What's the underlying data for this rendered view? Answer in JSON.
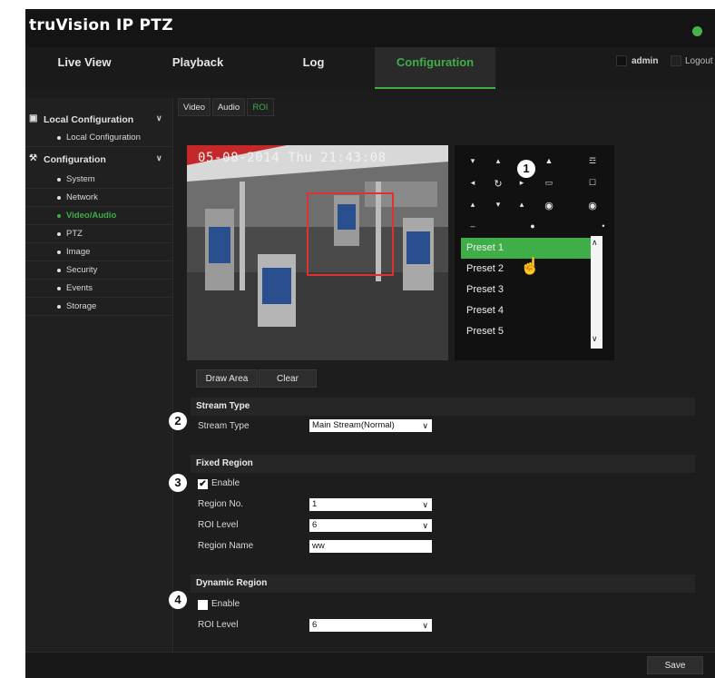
{
  "app": {
    "title": "truVision IP PTZ"
  },
  "nav": {
    "tabs": [
      "Live View",
      "Playback",
      "Log",
      "Configuration"
    ],
    "user": "admin",
    "logout": "Logout"
  },
  "sidebar": {
    "local_config": "Local Configuration",
    "local_items": [
      "Local Configuration"
    ],
    "configuration": "Configuration",
    "config_items": [
      "System",
      "Network",
      "Video/Audio",
      "PTZ",
      "Image",
      "Security",
      "Events",
      "Storage"
    ],
    "active_item": "Video/Audio"
  },
  "subtabs": [
    "Video",
    "Audio",
    "ROI"
  ],
  "video": {
    "osd_time": "05-08-2014 Thu 21:43:08"
  },
  "ptz": {
    "callout": "1",
    "presets": [
      "Preset 1",
      "Preset 2",
      "Preset 3",
      "Preset 4",
      "Preset 5"
    ],
    "active_preset": "Preset 1"
  },
  "roi_buttons": {
    "draw": "Draw Area",
    "clear": "Clear"
  },
  "stream": {
    "section": "Stream Type",
    "callout": "2",
    "label": "Stream Type",
    "value": "Main Stream(Normal)"
  },
  "fixed": {
    "section": "Fixed Region",
    "callout": "3",
    "enable": "Enable",
    "region_no_label": "Region No.",
    "region_no": "1",
    "roi_level_label": "ROI Level",
    "roi_level": "6",
    "region_name_label": "Region Name",
    "region_name": "ww"
  },
  "dynamic": {
    "section": "Dynamic Region",
    "callout": "4",
    "enable": "Enable",
    "roi_level_label": "ROI Level",
    "roi_level": "6"
  },
  "footer": {
    "save": "Save"
  },
  "colors": {
    "accent": "#3fae49",
    "roi_box": "#e03030",
    "background": "#1c1c1c"
  }
}
